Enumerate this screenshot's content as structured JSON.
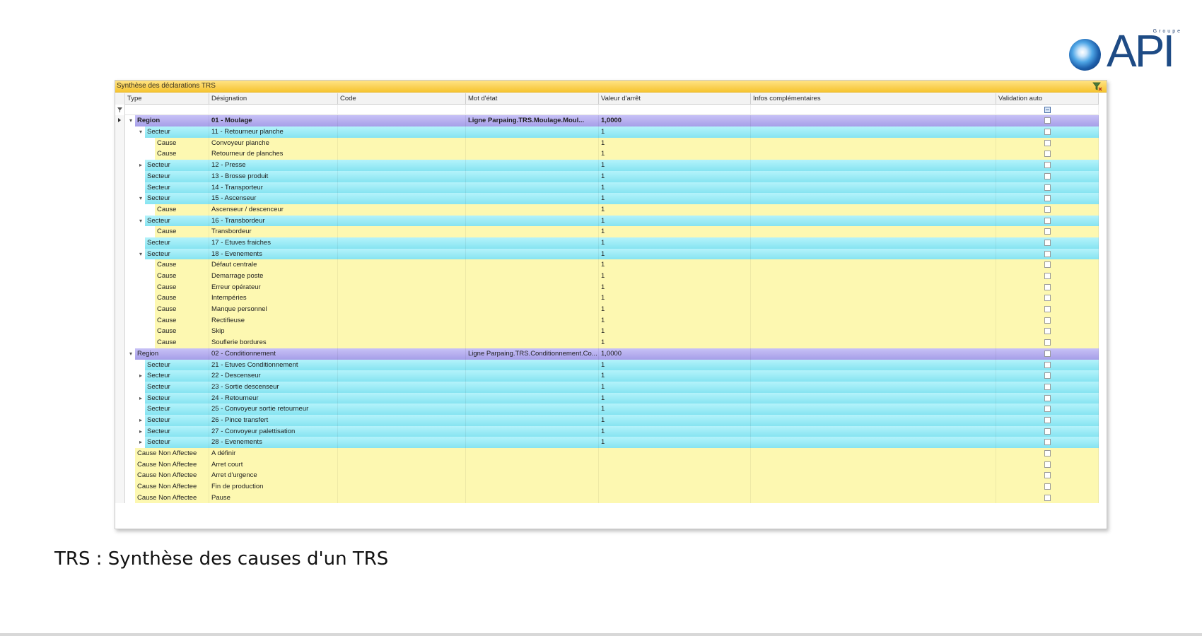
{
  "logo": {
    "groupe": "Groupe",
    "text": "API"
  },
  "window": {
    "title": "Synthèse des déclarations TRS"
  },
  "columns": [
    "Type",
    "Désignation",
    "Code",
    "Mot d'état",
    "Valeur d'arrêt",
    "Infos complémentaires",
    "Validation auto"
  ],
  "rows": [
    {
      "kind": "region",
      "level": 0,
      "expander": "collapse",
      "type": "Region",
      "designation": "01 - Moulage",
      "code": "",
      "mot_etat": "Ligne Parpaing.TRS.Moulage.Moul...",
      "valeur": "1,0000",
      "infos": "",
      "selected": true
    },
    {
      "kind": "secteur",
      "level": 1,
      "expander": "collapse",
      "type": "Secteur",
      "designation": "11 - Retourneur planche",
      "code": "",
      "mot_etat": "",
      "valeur": "1",
      "infos": ""
    },
    {
      "kind": "cause",
      "level": 2,
      "expander": "",
      "type": "Cause",
      "designation": "Convoyeur planche",
      "code": "",
      "mot_etat": "",
      "valeur": "1",
      "infos": ""
    },
    {
      "kind": "cause",
      "level": 2,
      "expander": "",
      "type": "Cause",
      "designation": "Retourneur de planches",
      "code": "",
      "mot_etat": "",
      "valeur": "1",
      "infos": ""
    },
    {
      "kind": "secteur",
      "level": 1,
      "expander": "expand",
      "type": "Secteur",
      "designation": "12 - Presse",
      "code": "",
      "mot_etat": "",
      "valeur": "1",
      "infos": ""
    },
    {
      "kind": "secteur",
      "level": 1,
      "expander": "",
      "type": "Secteur",
      "designation": "13 - Brosse produit",
      "code": "",
      "mot_etat": "",
      "valeur": "1",
      "infos": ""
    },
    {
      "kind": "secteur",
      "level": 1,
      "expander": "",
      "type": "Secteur",
      "designation": "14 - Transporteur",
      "code": "",
      "mot_etat": "",
      "valeur": "1",
      "infos": ""
    },
    {
      "kind": "secteur",
      "level": 1,
      "expander": "collapse",
      "type": "Secteur",
      "designation": "15 - Ascenseur",
      "code": "",
      "mot_etat": "",
      "valeur": "1",
      "infos": ""
    },
    {
      "kind": "cause",
      "level": 2,
      "expander": "",
      "type": "Cause",
      "designation": "Ascenseur / descenceur",
      "code": "",
      "mot_etat": "",
      "valeur": "1",
      "infos": ""
    },
    {
      "kind": "secteur",
      "level": 1,
      "expander": "collapse",
      "type": "Secteur",
      "designation": "16 - Transbordeur",
      "code": "",
      "mot_etat": "",
      "valeur": "1",
      "infos": ""
    },
    {
      "kind": "cause",
      "level": 2,
      "expander": "",
      "type": "Cause",
      "designation": "Transbordeur",
      "code": "",
      "mot_etat": "",
      "valeur": "1",
      "infos": ""
    },
    {
      "kind": "secteur",
      "level": 1,
      "expander": "",
      "type": "Secteur",
      "designation": "17 - Etuves fraiches",
      "code": "",
      "mot_etat": "",
      "valeur": "1",
      "infos": ""
    },
    {
      "kind": "secteur",
      "level": 1,
      "expander": "collapse",
      "type": "Secteur",
      "designation": "18 - Evenements",
      "code": "",
      "mot_etat": "",
      "valeur": "1",
      "infos": ""
    },
    {
      "kind": "cause",
      "level": 2,
      "expander": "",
      "type": "Cause",
      "designation": "Défaut centrale",
      "code": "",
      "mot_etat": "",
      "valeur": "1",
      "infos": ""
    },
    {
      "kind": "cause",
      "level": 2,
      "expander": "",
      "type": "Cause",
      "designation": "Demarrage poste",
      "code": "",
      "mot_etat": "",
      "valeur": "1",
      "infos": ""
    },
    {
      "kind": "cause",
      "level": 2,
      "expander": "",
      "type": "Cause",
      "designation": "Erreur opérateur",
      "code": "",
      "mot_etat": "",
      "valeur": "1",
      "infos": ""
    },
    {
      "kind": "cause",
      "level": 2,
      "expander": "",
      "type": "Cause",
      "designation": "Intempéries",
      "code": "",
      "mot_etat": "",
      "valeur": "1",
      "infos": ""
    },
    {
      "kind": "cause",
      "level": 2,
      "expander": "",
      "type": "Cause",
      "designation": "Manque personnel",
      "code": "",
      "mot_etat": "",
      "valeur": "1",
      "infos": ""
    },
    {
      "kind": "cause",
      "level": 2,
      "expander": "",
      "type": "Cause",
      "designation": "Rectifieuse",
      "code": "",
      "mot_etat": "",
      "valeur": "1",
      "infos": ""
    },
    {
      "kind": "cause",
      "level": 2,
      "expander": "",
      "type": "Cause",
      "designation": "Skip",
      "code": "",
      "mot_etat": "",
      "valeur": "1",
      "infos": ""
    },
    {
      "kind": "cause",
      "level": 2,
      "expander": "",
      "type": "Cause",
      "designation": "Souflerie bordures",
      "code": "",
      "mot_etat": "",
      "valeur": "1",
      "infos": ""
    },
    {
      "kind": "region",
      "level": 0,
      "expander": "collapse",
      "type": "Region",
      "designation": "02 - Conditionnement",
      "code": "",
      "mot_etat": "Ligne Parpaing.TRS.Conditionnement.Co...",
      "valeur": "1,0000",
      "infos": "",
      "normal": true
    },
    {
      "kind": "secteur",
      "level": 1,
      "expander": "",
      "type": "Secteur",
      "designation": "21 - Etuves Conditionnement",
      "code": "",
      "mot_etat": "",
      "valeur": "1",
      "infos": ""
    },
    {
      "kind": "secteur",
      "level": 1,
      "expander": "expand",
      "type": "Secteur",
      "designation": "22 - Descenseur",
      "code": "",
      "mot_etat": "",
      "valeur": "1",
      "infos": ""
    },
    {
      "kind": "secteur",
      "level": 1,
      "expander": "",
      "type": "Secteur",
      "designation": "23 - Sortie descenseur",
      "code": "",
      "mot_etat": "",
      "valeur": "1",
      "infos": ""
    },
    {
      "kind": "secteur",
      "level": 1,
      "expander": "expand",
      "type": "Secteur",
      "designation": "24 - Retourneur",
      "code": "",
      "mot_etat": "",
      "valeur": "1",
      "infos": ""
    },
    {
      "kind": "secteur",
      "level": 1,
      "expander": "",
      "type": "Secteur",
      "designation": "25 - Convoyeur sortie retourneur",
      "code": "",
      "mot_etat": "",
      "valeur": "1",
      "infos": ""
    },
    {
      "kind": "secteur",
      "level": 1,
      "expander": "expand",
      "type": "Secteur",
      "designation": "26 - Pince transfert",
      "code": "",
      "mot_etat": "",
      "valeur": "1",
      "infos": ""
    },
    {
      "kind": "secteur",
      "level": 1,
      "expander": "expand",
      "type": "Secteur",
      "designation": "27 - Convoyeur palettisation",
      "code": "",
      "mot_etat": "",
      "valeur": "1",
      "infos": ""
    },
    {
      "kind": "secteur",
      "level": 1,
      "expander": "expand",
      "type": "Secteur",
      "designation": "28 - Evenements",
      "code": "",
      "mot_etat": "",
      "valeur": "1",
      "infos": ""
    },
    {
      "kind": "cnaff",
      "level": 0,
      "expander": "",
      "type": "Cause Non Affectee",
      "designation": "A définir",
      "code": "",
      "mot_etat": "",
      "valeur": "",
      "infos": ""
    },
    {
      "kind": "cnaff",
      "level": 0,
      "expander": "",
      "type": "Cause Non Affectee",
      "designation": "Arret court",
      "code": "",
      "mot_etat": "",
      "valeur": "",
      "infos": ""
    },
    {
      "kind": "cnaff",
      "level": 0,
      "expander": "",
      "type": "Cause Non Affectee",
      "designation": "Arret d'urgence",
      "code": "",
      "mot_etat": "",
      "valeur": "",
      "infos": ""
    },
    {
      "kind": "cnaff",
      "level": 0,
      "expander": "",
      "type": "Cause Non Affectee",
      "designation": "Fin de production",
      "code": "",
      "mot_etat": "",
      "valeur": "",
      "infos": ""
    },
    {
      "kind": "cnaff",
      "level": 0,
      "expander": "",
      "type": "Cause Non Affectee",
      "designation": "Pause",
      "code": "",
      "mot_etat": "",
      "valeur": "",
      "infos": ""
    }
  ],
  "caption": "TRS : Synthèse des causes d'un TRS"
}
